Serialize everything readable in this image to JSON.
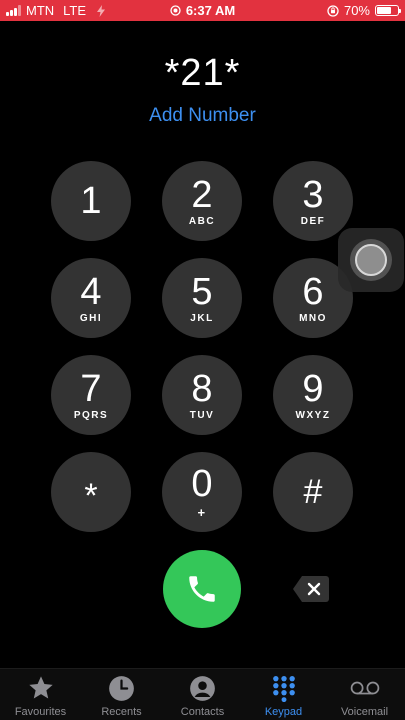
{
  "status_bar": {
    "carrier": "MTN",
    "network": "LTE",
    "time": "6:37 AM",
    "battery_percent": "70%",
    "battery_level": 0.7,
    "background_color": "#e2323f"
  },
  "dialer": {
    "number": "*21*",
    "add_number_label": "Add Number"
  },
  "keypad": [
    {
      "digit": "1",
      "letters": ""
    },
    {
      "digit": "2",
      "letters": "ABC"
    },
    {
      "digit": "3",
      "letters": "DEF"
    },
    {
      "digit": "4",
      "letters": "GHI"
    },
    {
      "digit": "5",
      "letters": "JKL"
    },
    {
      "digit": "6",
      "letters": "MNO"
    },
    {
      "digit": "7",
      "letters": "PQRS"
    },
    {
      "digit": "8",
      "letters": "TUV"
    },
    {
      "digit": "9",
      "letters": "WXYZ"
    },
    {
      "digit": "*",
      "letters": ""
    },
    {
      "digit": "0",
      "letters": "+"
    },
    {
      "digit": "#",
      "letters": ""
    }
  ],
  "actions": {
    "call_icon": "phone-icon",
    "delete_icon": "backspace-icon",
    "call_color": "#34c759"
  },
  "tabs": [
    {
      "label": "Favourites",
      "icon": "star-icon",
      "active": false
    },
    {
      "label": "Recents",
      "icon": "clock-icon",
      "active": false
    },
    {
      "label": "Contacts",
      "icon": "contact-icon",
      "active": false
    },
    {
      "label": "Keypad",
      "icon": "keypad-icon",
      "active": true
    },
    {
      "label": "Voicemail",
      "icon": "voicemail-icon",
      "active": false
    }
  ],
  "accent_color": "#3d8ff0"
}
